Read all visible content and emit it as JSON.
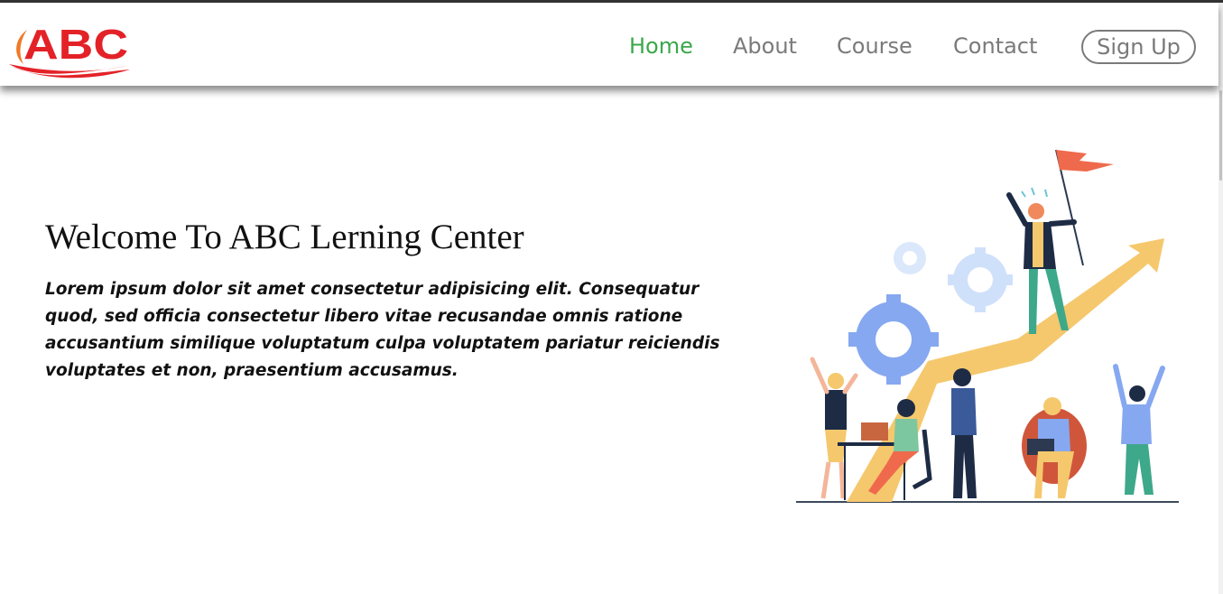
{
  "logo": {
    "text": "ABC",
    "color": "#e32227",
    "accent": "#f07a28"
  },
  "nav": {
    "items": [
      {
        "label": "Home",
        "active": true
      },
      {
        "label": "About",
        "active": false
      },
      {
        "label": "Course",
        "active": false
      },
      {
        "label": "Contact",
        "active": false
      }
    ],
    "signup_label": "Sign Up",
    "active_color": "#3aa84a",
    "color": "#7a7a7a"
  },
  "hero": {
    "title": "Welcome To ABC Lerning Center",
    "text": "Lorem ipsum dolor sit amet consectetur adipisicing elit. Consequatur quod, sed officia consectetur libero vitae recusandae omnis ratione accusantium similique voluptatum culpa voluptatem pariatur reiciendis voluptates et non, praesentium accusamus."
  },
  "illustration": {
    "subject": "team-success-illustration"
  }
}
